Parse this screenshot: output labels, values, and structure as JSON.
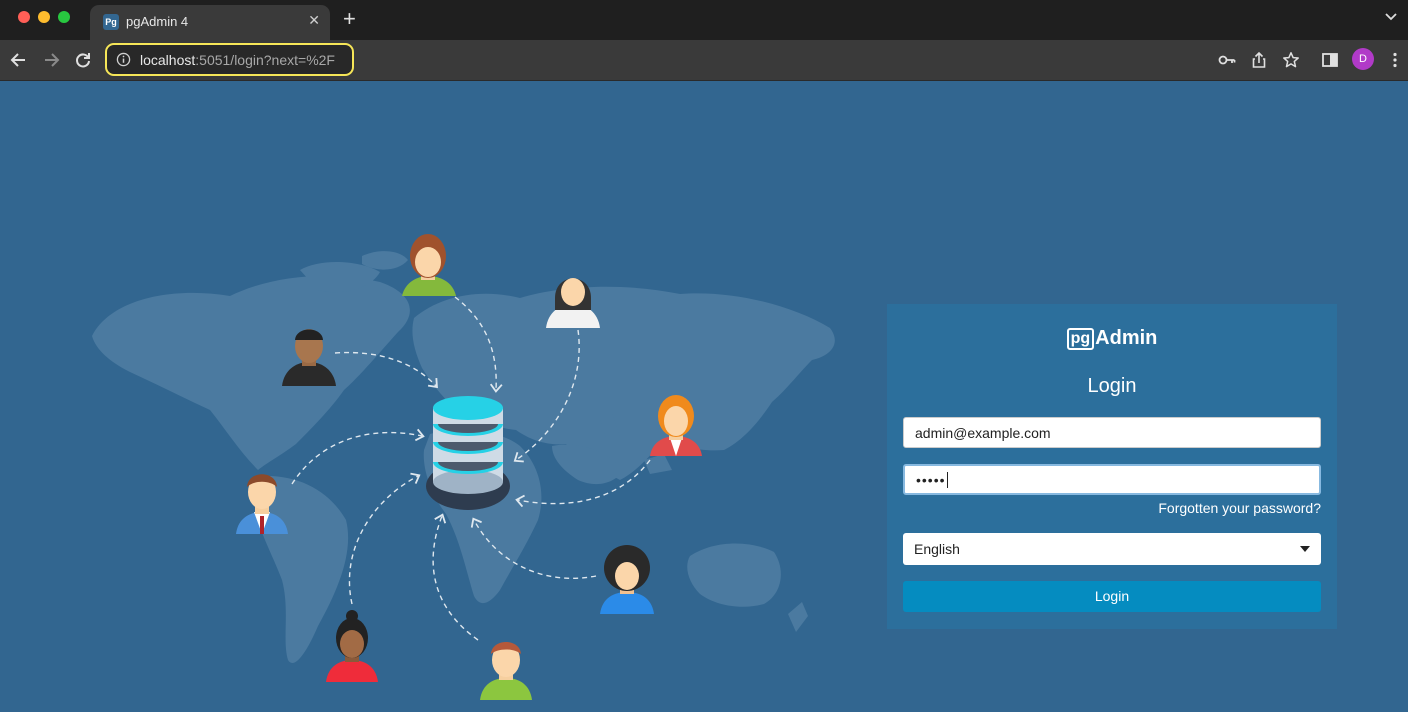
{
  "browser": {
    "tab_title": "pgAdmin 4",
    "tab_favicon_text": "Pg",
    "address_host": "localhost",
    "address_rest": ":5051/login?next=%2F",
    "profile_initial": "D",
    "colors": {
      "tabbar": "#1f1f1f",
      "toolbar": "#3a3a3a",
      "omnibox_focus": "#f6e658",
      "profile": "#b13ac8"
    }
  },
  "page": {
    "brand_pg": "pg",
    "brand_name": "Admin",
    "heading": "Login",
    "email_value": "admin@example.com",
    "password_masked": "•••••",
    "forgot_link": "Forgotten your password?",
    "language_selected": "English",
    "login_button": "Login",
    "colors": {
      "background": "#326690",
      "panel": "#2c6f9c",
      "button": "#058cc0"
    }
  },
  "illustration": {
    "icons": [
      "world-map",
      "database-stack-icon",
      "user-avatar-icon"
    ]
  }
}
